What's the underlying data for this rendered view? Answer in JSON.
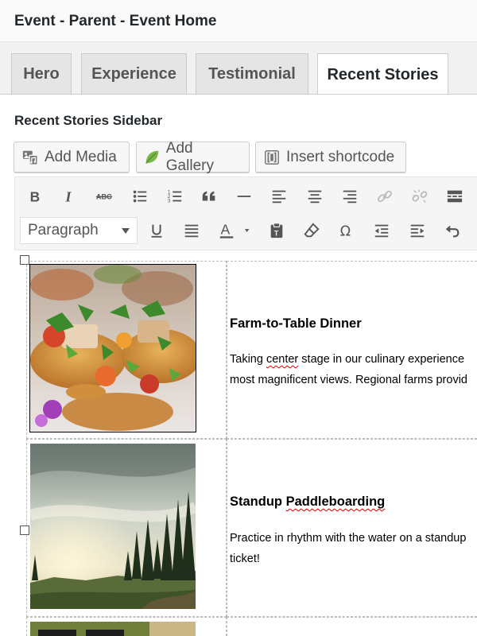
{
  "page": {
    "title": "Event - Parent - Event Home"
  },
  "tabs": [
    {
      "label": "Hero",
      "active": false
    },
    {
      "label": "Experience",
      "active": false
    },
    {
      "label": "Testimonial",
      "active": false
    },
    {
      "label": "Recent Stories",
      "active": true
    }
  ],
  "field": {
    "label": "Recent Stories Sidebar"
  },
  "media_buttons": {
    "add_media": "Add Media",
    "add_gallery": "Add Gallery",
    "insert_shortcode": "Insert shortcode"
  },
  "toolbar": {
    "row1_icons": [
      "bold-icon",
      "italic-icon",
      "strikethrough-icon",
      "bullet-list-icon",
      "numbered-list-icon",
      "blockquote-icon",
      "horizontal-rule-icon",
      "align-left-icon",
      "align-center-icon",
      "align-right-icon",
      "link-icon",
      "unlink-icon",
      "read-more-icon"
    ],
    "format_select": "Paragraph",
    "row2_icons": [
      "underline-icon",
      "justify-icon",
      "text-color-icon",
      "paste-text-icon",
      "clear-formatting-icon",
      "special-character-icon",
      "outdent-icon",
      "indent-icon",
      "undo-icon"
    ]
  },
  "stories": [
    {
      "title": "Farm-to-Table Dinner",
      "lines": [
        [
          "Taking ",
          "center",
          " stage in our culinary experience"
        ],
        [
          "most magnificent views. Regional farms provid",
          "",
          ""
        ]
      ],
      "image": "food-photo"
    },
    {
      "title_parts": [
        "Standup ",
        "Paddleboarding"
      ],
      "lines": [
        [
          "Practice in rhythm with the water on a standup",
          "",
          ""
        ],
        [
          "ticket!",
          "",
          ""
        ]
      ],
      "image": "landscape-photo"
    }
  ],
  "colors": {
    "accent": "#0073aa",
    "text": "#23282d",
    "gallery_leaf": "#7ab648"
  }
}
